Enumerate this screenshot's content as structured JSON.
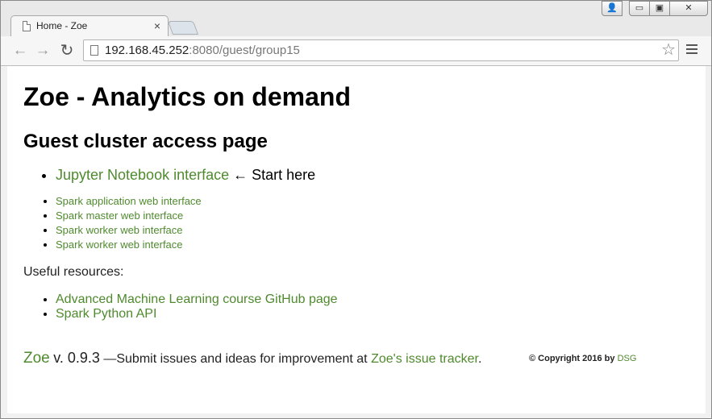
{
  "browser": {
    "tab_title": "Home - Zoe",
    "tab_close": "×",
    "url_host": "192.168.45.252",
    "url_path": ":8080/guest/group15",
    "window_buttons": {
      "user": "👤",
      "minimize": "▭",
      "maximize": "▣",
      "close": "✕"
    },
    "nav": {
      "back": "←",
      "forward": "→",
      "reload": "↻",
      "star": "☆"
    }
  },
  "page": {
    "title": "Zoe - Analytics on demand",
    "subtitle": "Guest cluster access page",
    "primary_link": {
      "label": "Jupyter Notebook interface",
      "suffix": "← Start here"
    },
    "service_links": [
      "Spark application web interface",
      "Spark master web interface",
      "Spark worker web interface",
      "Spark worker web interface"
    ],
    "resources_label": "Useful resources:",
    "resources": [
      "Advanced Machine Learning course GitHub page",
      "Spark Python API"
    ],
    "footer": {
      "brand": "Zoe",
      "version": "v. 0.9.3",
      "text": "—Submit issues and ideas for improvement at",
      "tracker_link": "Zoe's issue tracker",
      "period": ".",
      "copyright": "© Copyright 2016 by",
      "copyright_link": "DSG"
    }
  },
  "colors": {
    "link": "#4f8a2e"
  }
}
